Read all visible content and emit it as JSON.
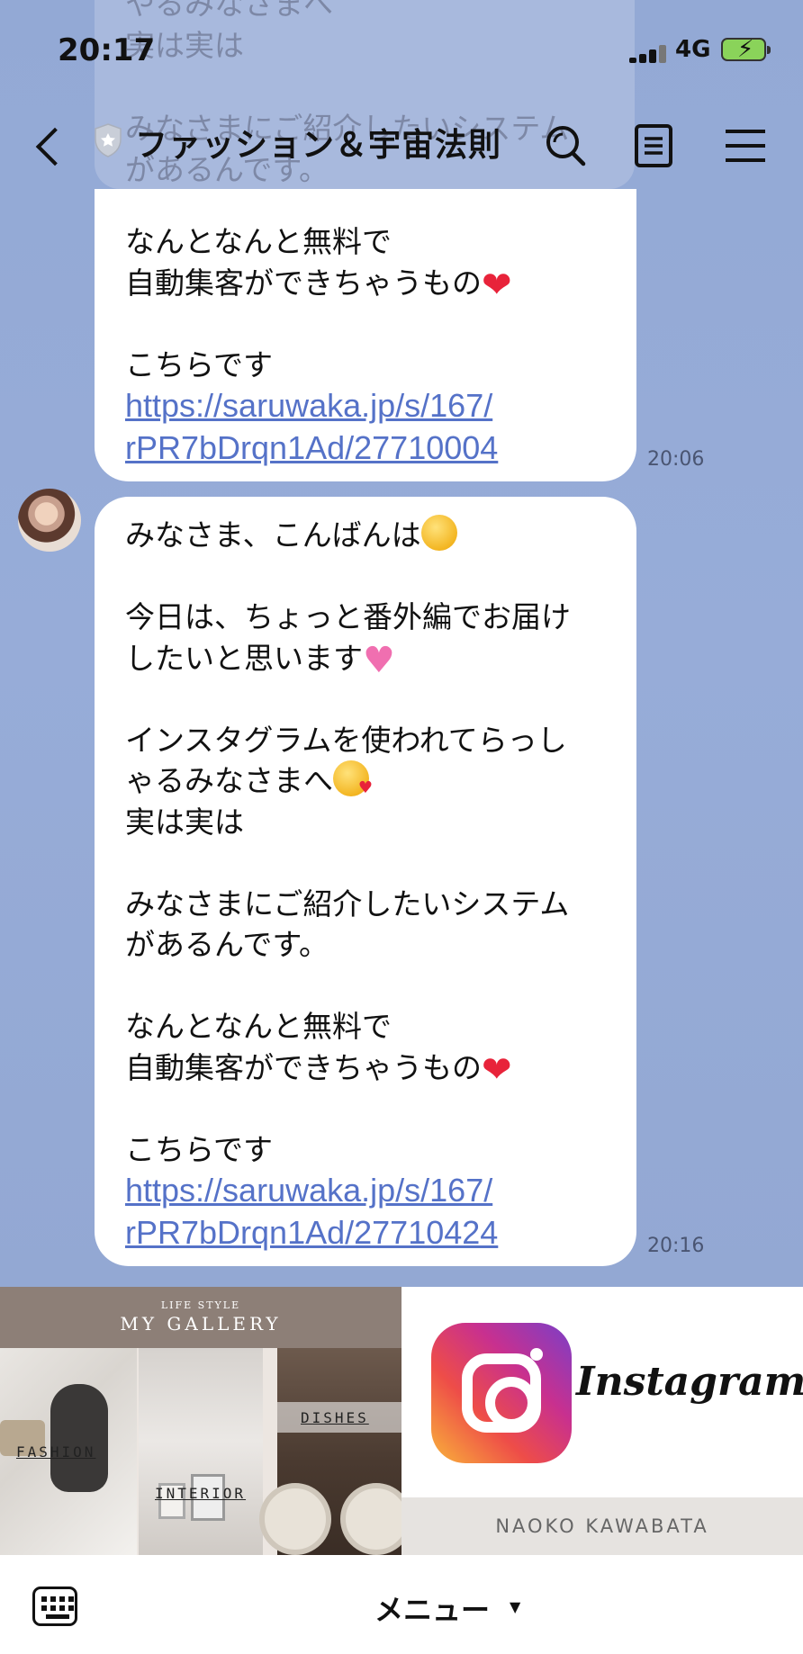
{
  "status": {
    "time": "20:17",
    "network": "4G"
  },
  "header": {
    "title": "ファッション＆宇宙法則"
  },
  "ghost_lines": [
    "やるみなさまへ",
    "実は実は",
    "",
    "みなさまにご紹介したいシステム",
    "があるんです。"
  ],
  "message1": {
    "line1": "なんとなんと無料で",
    "line2": "自動集客ができちゃうもの",
    "line3": "こちらです",
    "link1": "https://saruwaka.jp/s/167/",
    "link2": "rPR7bDrqn1Ad/27710004",
    "time": "20:06"
  },
  "message2": {
    "greeting": "みなさま、こんばんは",
    "p2a": "今日は、ちょっと番外編でお届け",
    "p2b": "したいと思います",
    "p3a": "インスタグラムを使われてらっし",
    "p3b": "ゃるみなさまへ",
    "p3c": "実は実は",
    "p4a": "みなさまにご紹介したいシステム",
    "p4b": "があるんです。",
    "p5a": "なんとなんと無料で",
    "p5b": "自動集客ができちゃうもの",
    "p6": "こちらです",
    "link1": "https://saruwaka.jp/s/167/",
    "link2": "rPR7bDrqn1Ad/27710424",
    "time": "20:16"
  },
  "menu": {
    "gallery_sub": "LIFE STYLE",
    "gallery_title": "MY GALLERY",
    "fashion": "FASHION",
    "interior": "INTERIOR",
    "dishes": "DISHES",
    "instagram": "Instagram",
    "owner": "NAOKO KAWABATA"
  },
  "bottom": {
    "menu_label": "メニュー"
  },
  "colors": {
    "chat_bg": "#96abd6",
    "link": "#5572c8"
  }
}
